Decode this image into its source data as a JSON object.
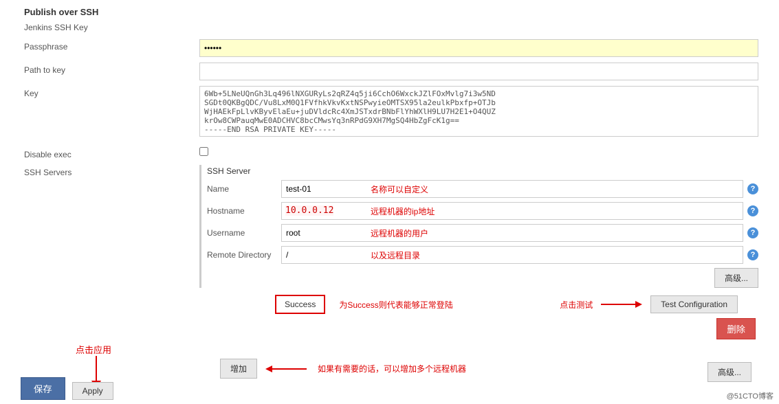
{
  "section": {
    "title": "Publish over SSH",
    "subtitle": "Jenkins SSH Key"
  },
  "fields": {
    "passphrase_label": "Passphrase",
    "passphrase_value": "••••••",
    "path_to_key_label": "Path to key",
    "path_to_key_value": "",
    "key_label": "Key",
    "key_value": "6Wb+5LNeUQnGh3Lq496lNXGURyLs2qRZ4q5ji6CchO6WxckJZlFOxMvlg7i3w5ND\nSGDt0QKBgQDC/Vu8LxM0Q1FVfhkVkvKxtNSPwyieOMTSX95la2eulkPbxfp+OTJb\nWjHAEkFpLlvKByvElaEu+juDVldcRc4XmJSTxdrBNbFlYhWXlH9LU7H2E1+O4QUZ\nkrOw8CWPauqMwE0ADCHVC8bcCMwsYq3nRPdG9XH7MgSQ4HbZgFcK1g==\n-----END RSA PRIVATE KEY-----",
    "disable_exec_label": "Disable exec",
    "ssh_servers_label": "SSH Servers"
  },
  "server": {
    "title": "SSH Server",
    "name_label": "Name",
    "name_value": "test-01",
    "name_note": "名称可以自定义",
    "hostname_label": "Hostname",
    "hostname_value": "",
    "hostname_ip": "10.0.0.12",
    "hostname_note": "远程机器的ip地址",
    "username_label": "Username",
    "username_value": "root",
    "username_note": "远程机器的用户",
    "remote_dir_label": "Remote Directory",
    "remote_dir_value": "/",
    "remote_dir_note": "以及远程目录"
  },
  "buttons": {
    "advanced": "高级...",
    "success": "Success",
    "success_note": "为Success则代表能够正常登陆",
    "test_note": "点击测试",
    "test_config": "Test Configuration",
    "delete": "删除",
    "add": "增加",
    "add_note": "如果有需要的话，可以增加多个远程机器",
    "advanced2": "高级...",
    "save": "保存",
    "apply": "Apply",
    "apply_note": "点击应用"
  },
  "watermark": "@51CTO博客"
}
